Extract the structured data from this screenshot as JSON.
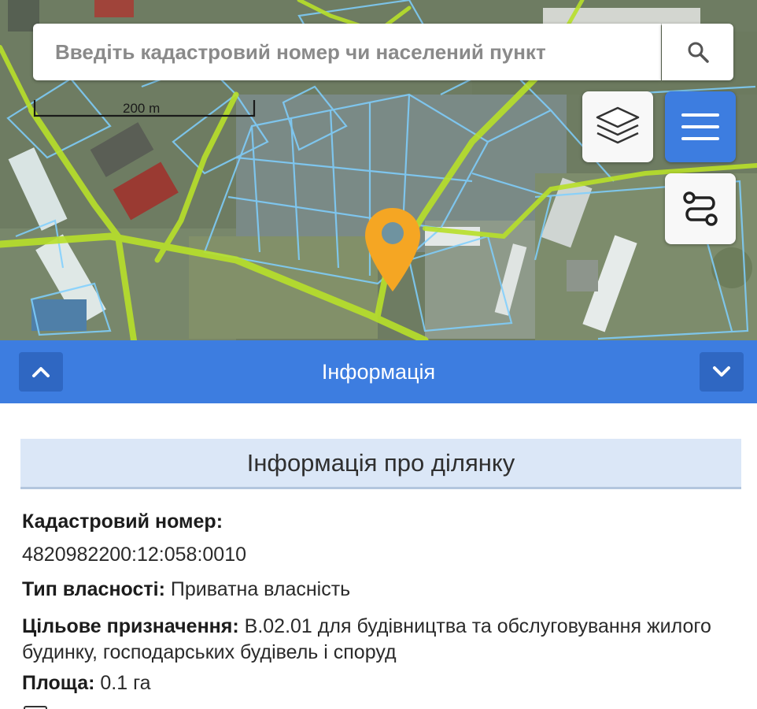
{
  "search": {
    "placeholder": "Введіть кадастровий номер чи населений пункт"
  },
  "map": {
    "scale_label": "200 m"
  },
  "info_bar": {
    "title": "Інформація"
  },
  "panel": {
    "header": "Інформація про ділянку",
    "cadastral_label": "Кадастровий номер:",
    "cadastral_value": "4820982200:12:058:0010",
    "ownership_label": "Тип власності:",
    "ownership_value": "Приватна власність",
    "purpose_label": "Цільове призначення:",
    "purpose_value": "В.02.01 для будівництва та обслуговування жилого будинку, господарських будівель і споруд",
    "area_label": "Площа:",
    "area_value": "0.1 га"
  },
  "icons": {
    "search": "search-icon",
    "layers": "layers-icon",
    "menu": "hamburger-menu-icon",
    "route": "route-icon",
    "pin": "location-pin-icon",
    "collapse": "chevron-up-icon",
    "expand": "chevron-down-icon"
  },
  "colors": {
    "accent": "#3d7de0",
    "pin": "#f5a623",
    "parcel_lines": "#7fd0ff",
    "road_highlight": "#b8e02a",
    "panel_header_bg": "#dbe7f7"
  }
}
